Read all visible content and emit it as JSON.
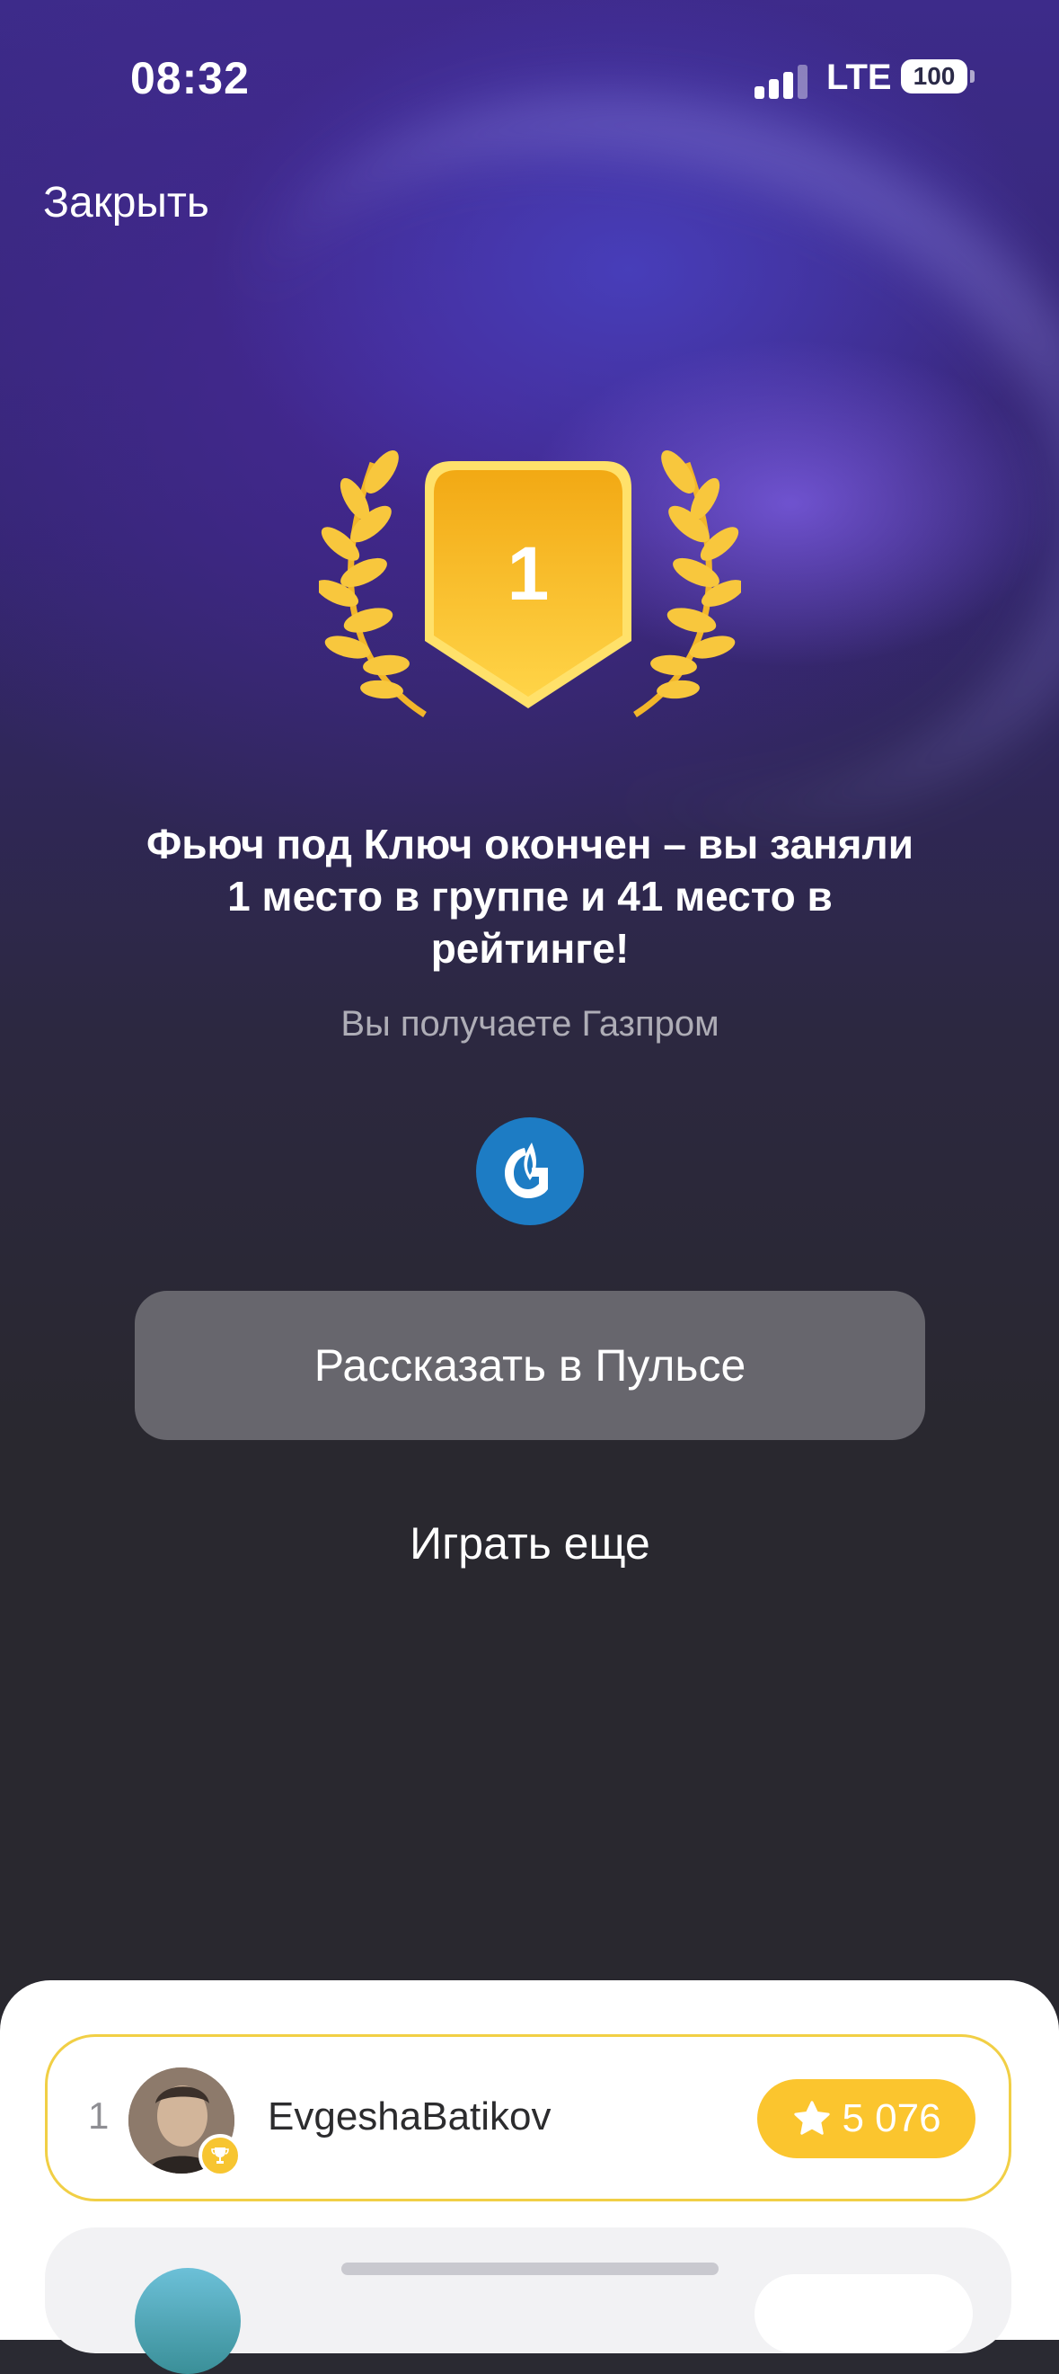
{
  "status_bar": {
    "time": "08:32",
    "network": "LTE",
    "battery": "100"
  },
  "header": {
    "close_label": "Закрыть"
  },
  "result": {
    "place": "1",
    "headline": "Фьюч под Ключ окончен – вы заняли 1 место в группе и 41 место в рейтинге!",
    "reward_text": "Вы получаете Газпром",
    "reward_icon": "gazprom-logo-icon"
  },
  "actions": {
    "share_label": "Рассказать в Пульсе",
    "play_again_label": "Играть еще"
  },
  "leaderboard": {
    "rows": [
      {
        "rank": "1",
        "username": "EvgeshaBatikov",
        "score": "5 076",
        "highlighted": true
      }
    ]
  },
  "colors": {
    "accent_gold": "#FBC52E",
    "share_button": "#67666D",
    "gazprom_blue": "#1D7CC4"
  }
}
